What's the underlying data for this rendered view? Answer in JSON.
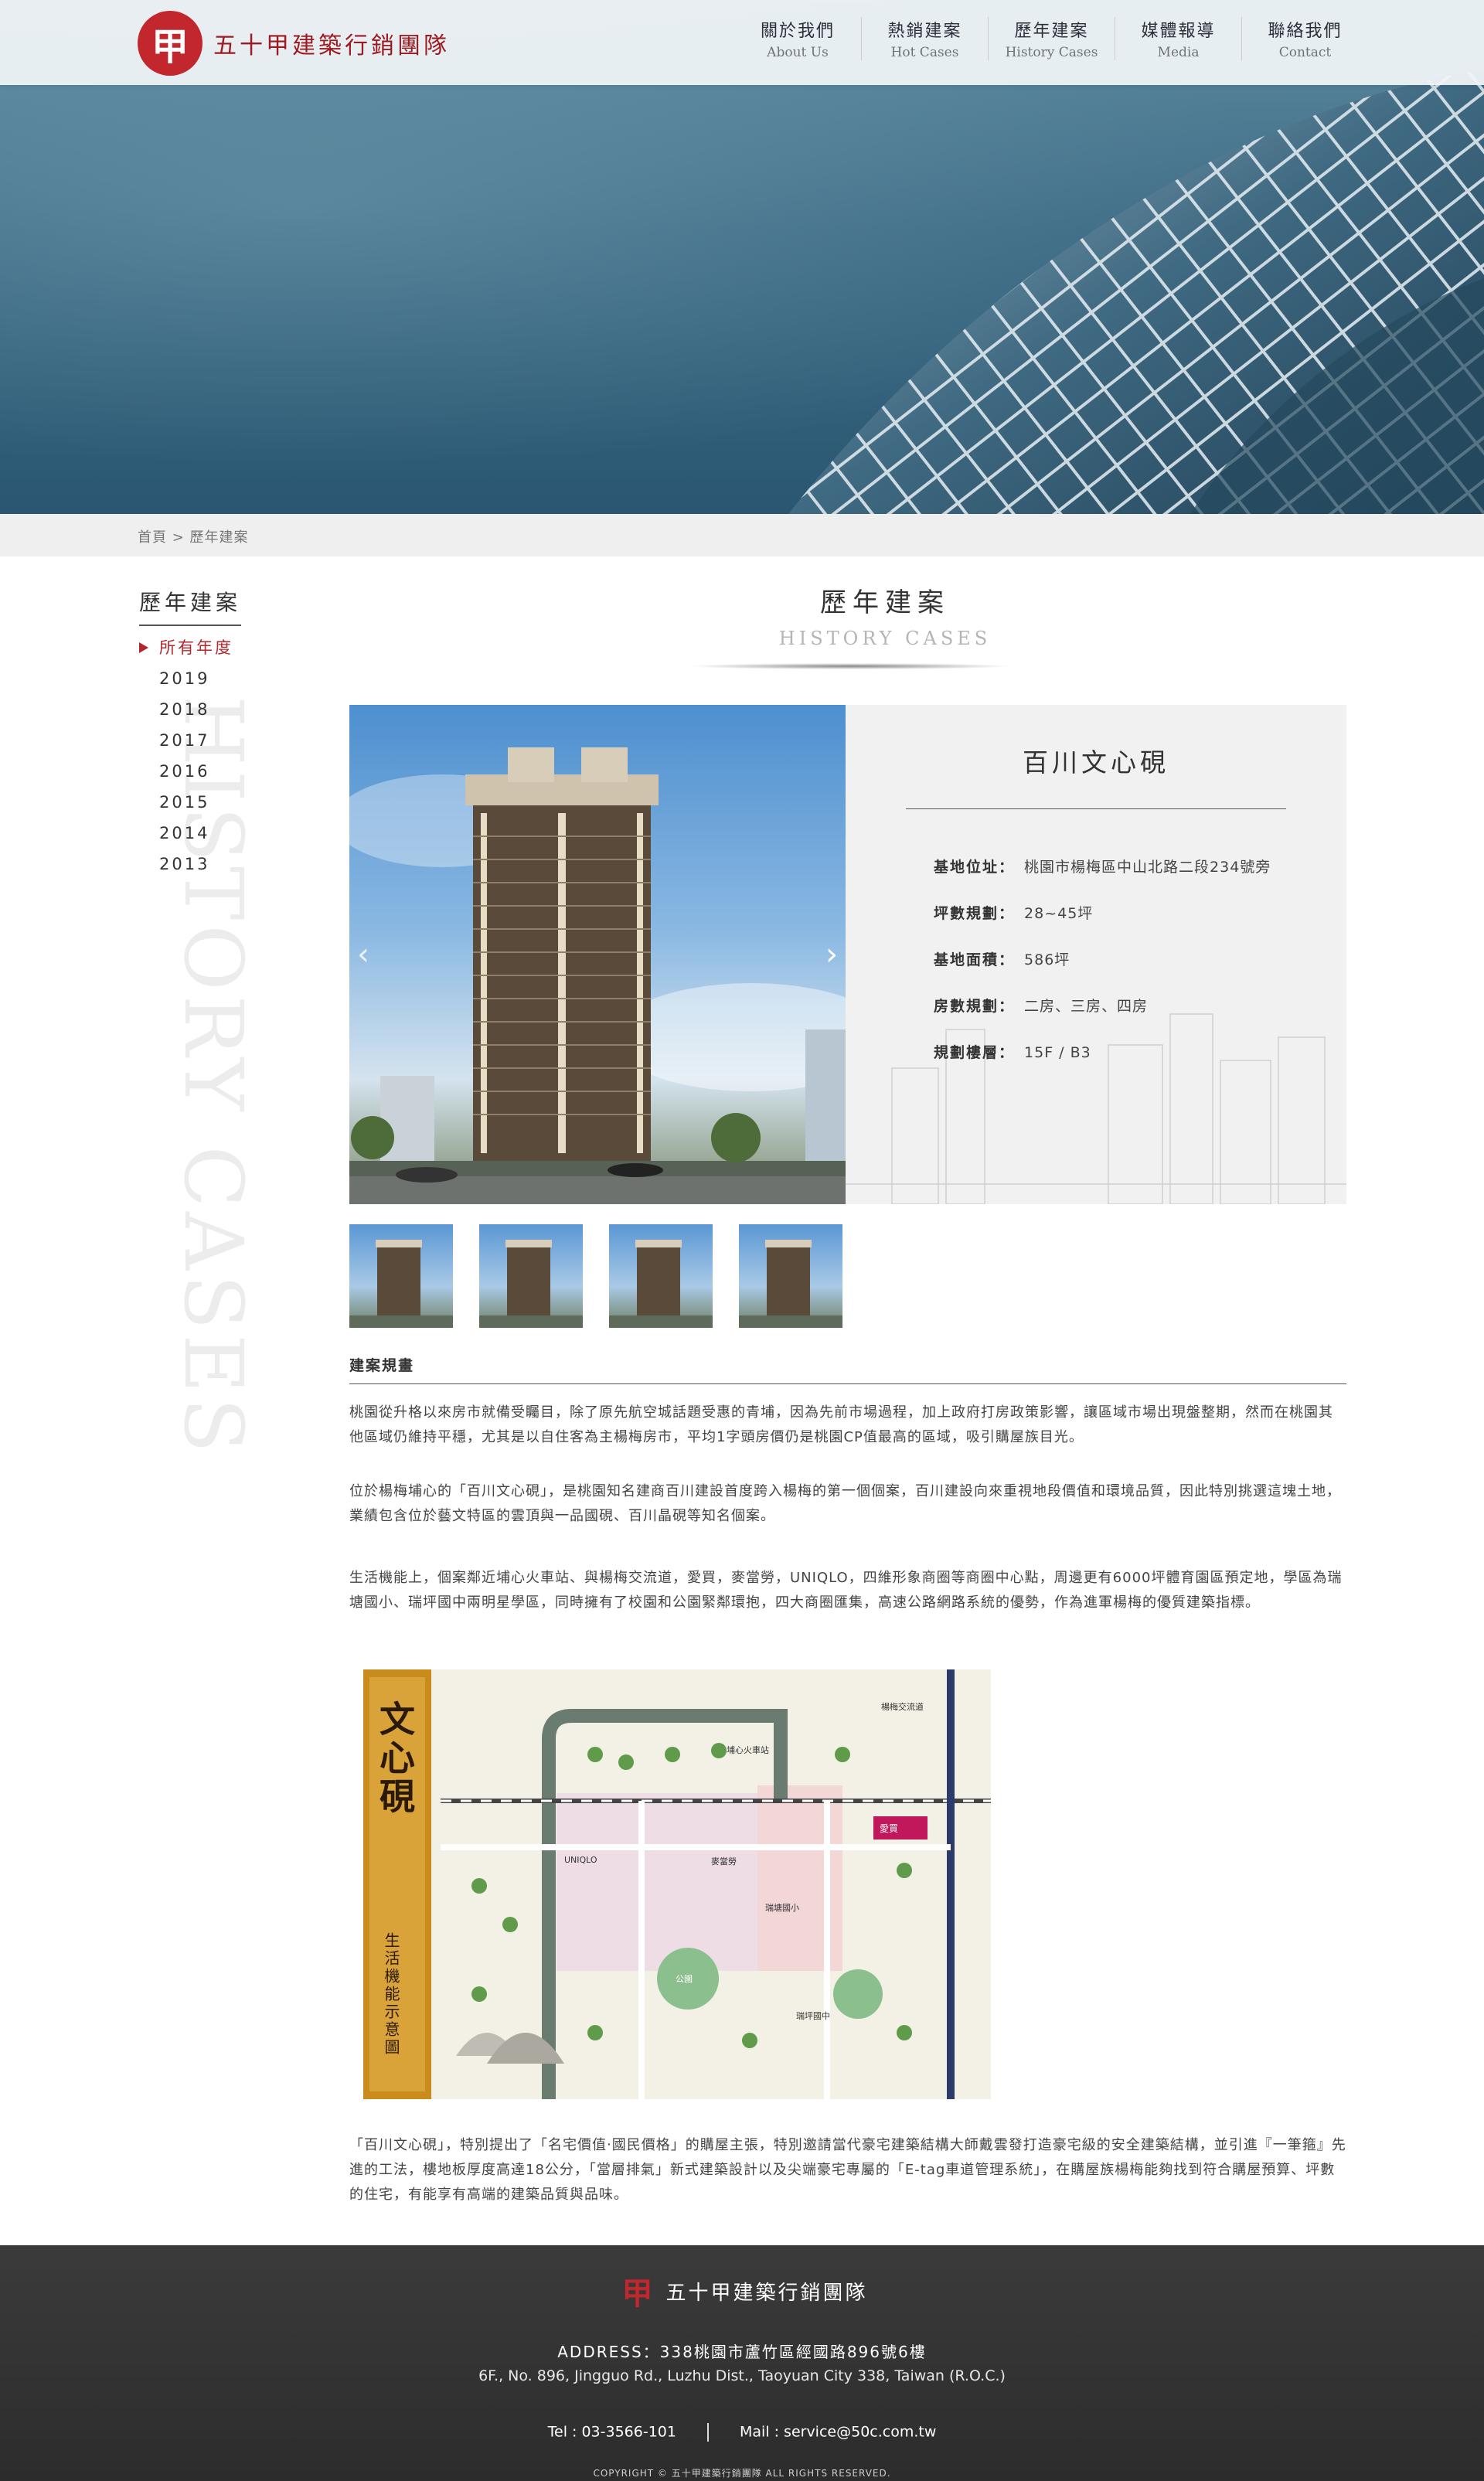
{
  "brand": {
    "name": "五十甲建築行銷團隊",
    "seal_char": "甲"
  },
  "nav": [
    {
      "zh": "關於我們",
      "en": "About Us"
    },
    {
      "zh": "熱銷建案",
      "en": "Hot Cases"
    },
    {
      "zh": "歷年建案",
      "en": "History Cases"
    },
    {
      "zh": "媒體報導",
      "en": "Media"
    },
    {
      "zh": "聯絡我們",
      "en": "Contact"
    }
  ],
  "breadcrumb": "首頁 > 歷年建案",
  "sidebar": {
    "title": "歷年建案",
    "items": [
      "所有年度",
      "2019",
      "2018",
      "2017",
      "2016",
      "2015",
      "2014",
      "2013"
    ],
    "watermark": "HISTORY CASES"
  },
  "section": {
    "title": "歷年建案",
    "subtitle": "HISTORY CASES"
  },
  "project": {
    "name": "百川文心硯",
    "rows": [
      {
        "label": "基地位址：",
        "value": "桃園市楊梅區中山北路二段234號旁"
      },
      {
        "label": "坪數規劃：",
        "value": "28~45坪"
      },
      {
        "label": "基地面積：",
        "value": "586坪"
      },
      {
        "label": "房數規劃：",
        "value": "二房、三房、四房"
      },
      {
        "label": "規劃樓層：",
        "value": "15F / B3"
      }
    ]
  },
  "plan": {
    "title": "建案規畫",
    "paragraphs": [
      "桃園從升格以來房市就備受矚目，除了原先航空城話題受惠的青埔，因為先前市場過程，加上政府打房政策影響，讓區域市場出現盤整期，然而在桃園其他區域仍維持平穩，尤其是以自住客為主楊梅房市，平均1字頭房價仍是桃園CP值最高的區域，吸引購屋族目光。",
      "位於楊梅埔心的「百川文心硯」，是桃園知名建商百川建設首度跨入楊梅的第一個個案，百川建設向來重視地段價值和環境品質，因此特別挑選這塊土地，業績包含位於藝文特區的雲頂與一品國硯、百川晶硯等知名個案。",
      "生活機能上，個案鄰近埔心火車站、與楊梅交流道，愛買，麥當勞，UNIQLO，四維形象商圈等商圈中心點，周邊更有6000坪體育園區預定地，學區為瑞塘國小、瑞坪國中兩明星學區，同時擁有了校園和公園緊鄰環抱，四大商圈匯集，高速公路網路系統的優勢，作為進軍楊梅的優質建築指標。",
      "「百川文心硯」，特別提出了「名宅價值‧國民價格」的購屋主張，特別邀請當代豪宅建築結構大師戴雲發打造豪宅級的安全建築結構，並引進『一筆箍』先進的工法，樓地板厚度高達18公分，「當層排氣」新式建築設計以及尖端豪宅專屬的「E-tag車道管理系統」，在購屋族楊梅能夠找到符合購屋預算、坪數的住宅，有能享有高端的建築品質與品味。"
    ]
  },
  "map": {
    "brand_title": "文心硯",
    "side_caption": "生活機能示意圖",
    "labels": [
      "埔心火車站",
      "楊梅交流道",
      "愛買",
      "麥當勞",
      "UNIQLO",
      "瑞塘國小",
      "瑞坪國中",
      "公園"
    ]
  },
  "footer": {
    "brand": "五十甲建築行銷團隊",
    "address_zh": "ADDRESS：338桃園市蘆竹區經國路896號6樓",
    "address_en": "6F., No. 896, Jingguo Rd., Luzhu Dist., Taoyuan City 338, Taiwan (R.O.C.)",
    "tel": "Tel : 03-3566-101",
    "mail": "Mail : service@50c.com.tw",
    "copyright": "COPYRIGHT © 五十甲建築行銷團隊 ALL RIGHTS RESERVED."
  },
  "colors": {
    "accent": "#b3262c",
    "seal": "#c1272d",
    "footer_bg": "#333333"
  }
}
